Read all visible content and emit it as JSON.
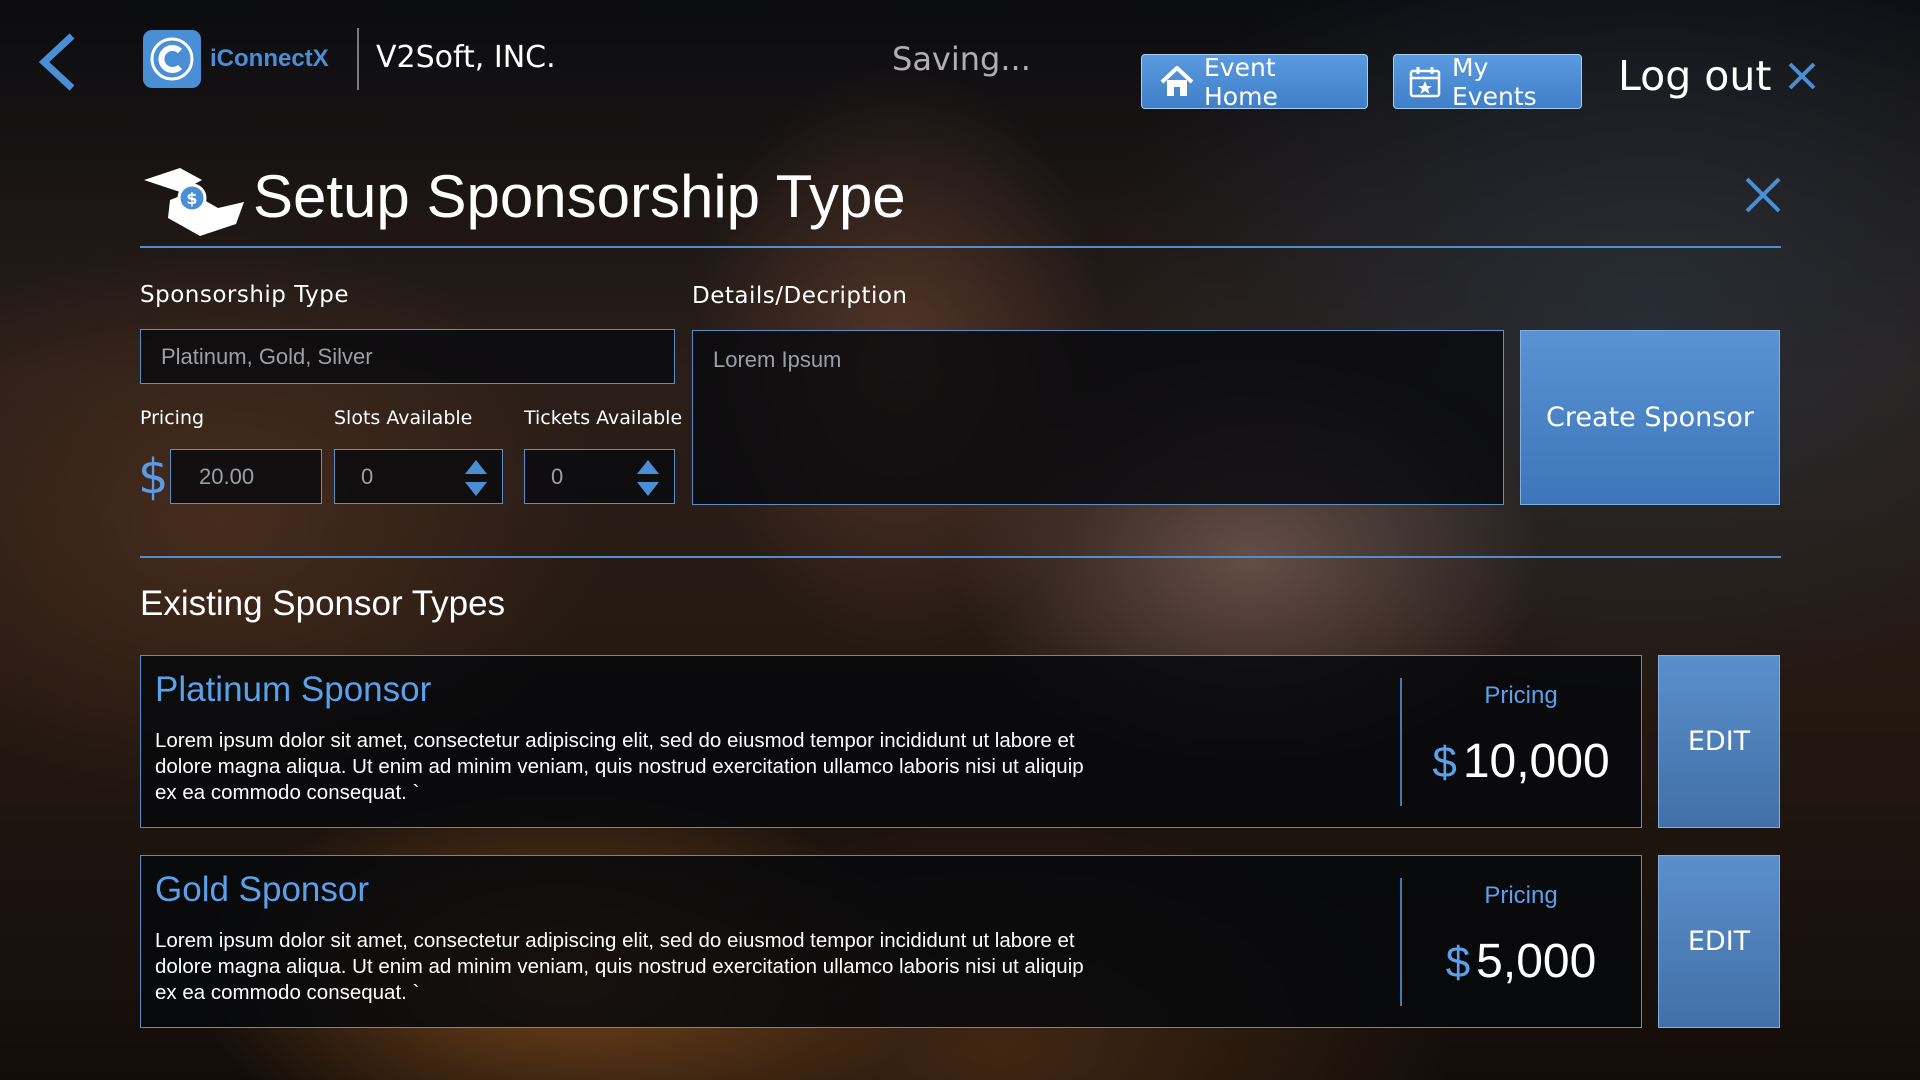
{
  "header": {
    "brand": "iConnectX",
    "company": "V2Soft, INC.",
    "status": "Saving...",
    "event_home_label": "Event Home",
    "my_events_label": "My Events",
    "logout_label": "Log out"
  },
  "page": {
    "title": "Setup Sponsorship Type"
  },
  "form": {
    "sponsorship_type_label": "Sponsorship Type",
    "sponsorship_type_placeholder": "Platinum, Gold, Silver",
    "details_label": "Details/Decription",
    "details_placeholder": "Lorem Ipsum",
    "pricing_label": "Pricing",
    "currency": "$",
    "pricing_value": "20.00",
    "slots_label": "Slots Available",
    "slots_value": "0",
    "tickets_label": "Tickets Available",
    "tickets_value": "0",
    "create_label": "Create Sponsor"
  },
  "existing": {
    "title": "Existing Sponsor Types",
    "items": [
      {
        "name": "Platinum Sponsor",
        "description": "Lorem ipsum dolor sit amet, consectetur adipiscing elit, sed do eiusmod tempor incididunt ut labore et dolore magna aliqua. Ut enim ad minim veniam, quis nostrud exercitation ullamco laboris nisi ut aliquip ex ea commodo consequat. `",
        "pricing_label": "Pricing",
        "currency": "$",
        "price": "10,000",
        "edit_label": "EDIT"
      },
      {
        "name": "Gold Sponsor",
        "description": "Lorem ipsum dolor sit amet, consectetur adipiscing elit, sed do eiusmod tempor incididunt ut labore et dolore magna aliqua. Ut enim ad minim veniam, quis nostrud exercitation ullamco laboris nisi ut aliquip ex ea commodo consequat. `",
        "pricing_label": "Pricing",
        "currency": "$",
        "price": "5,000",
        "edit_label": "EDIT"
      }
    ]
  },
  "icons": {
    "back": "chevron-left-icon",
    "logo": "iconnectx-logo-icon",
    "event_home": "home-icon",
    "my_events": "calendar-star-icon",
    "logout": "close-icon",
    "title": "sponsorship-handshake-icon",
    "panel_close": "close-icon",
    "spinner": "up-down-arrows-icon"
  },
  "colors": {
    "accent": "#4a8fd6",
    "button": "#4f8ad0",
    "text": "#ffffff"
  }
}
